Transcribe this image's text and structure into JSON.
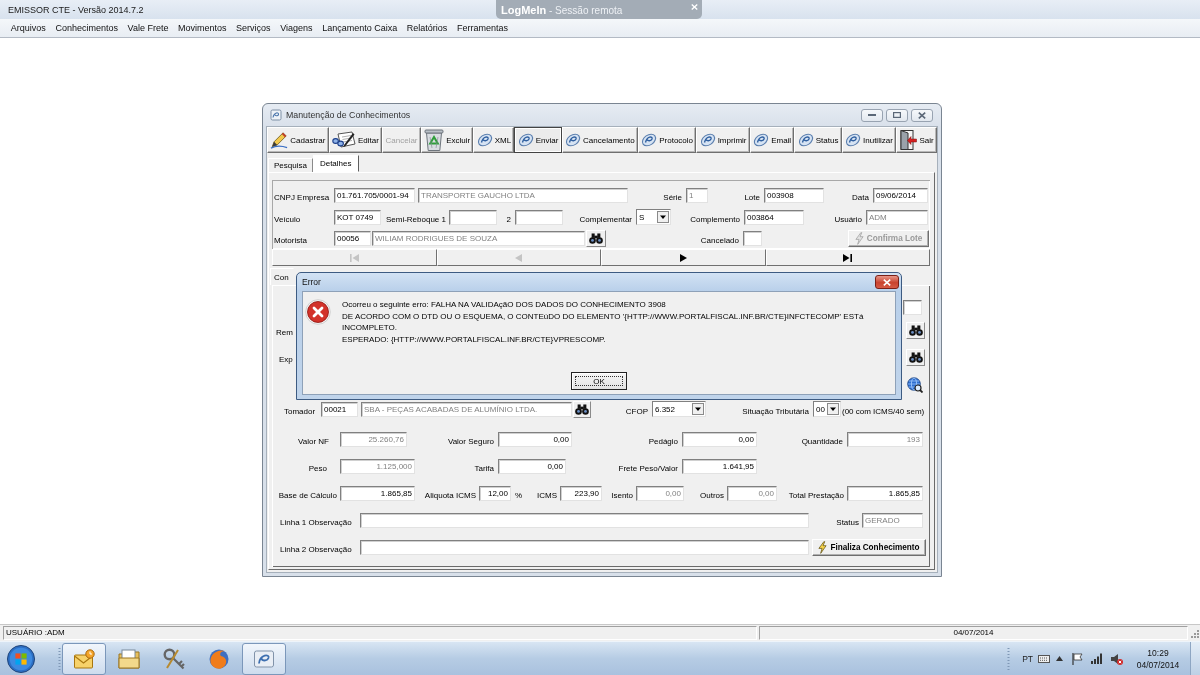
{
  "app": {
    "title": "EMISSOR CTE - Versão 2014.7.2",
    "menu": [
      "Arquivos",
      "Conhecimentos",
      "Vale Frete",
      "Movimentos",
      "Serviços",
      "Viagens",
      "Lançamento Caixa",
      "Relatórios",
      "Ferramentas"
    ]
  },
  "remote_banner": {
    "text": "**LogMeIn** - Sessão remota"
  },
  "window": {
    "title": "Manutenção de Conhecimentos",
    "toolbar": [
      {
        "label": "Cadastrar",
        "kind": "pen",
        "disabled": false,
        "pressed": false
      },
      {
        "label": "Editar",
        "kind": "writing",
        "disabled": false,
        "pressed": false
      },
      {
        "label": "Cancelar",
        "kind": "plain",
        "disabled": true,
        "pressed": false
      },
      {
        "label": "Excluir",
        "kind": "recycle",
        "disabled": false,
        "pressed": false
      },
      {
        "label": "XML",
        "kind": "swirl",
        "disabled": false,
        "pressed": false
      },
      {
        "label": "Enviar",
        "kind": "swirl",
        "disabled": false,
        "pressed": true
      },
      {
        "label": "Cancelamento",
        "kind": "swirl",
        "disabled": false,
        "pressed": false
      },
      {
        "label": "Protocolo",
        "kind": "swirl",
        "disabled": false,
        "pressed": false
      },
      {
        "label": "Imprimir",
        "kind": "swirl",
        "disabled": false,
        "pressed": false
      },
      {
        "label": "Email",
        "kind": "swirl",
        "disabled": false,
        "pressed": false
      },
      {
        "label": "Status",
        "kind": "swirl",
        "disabled": false,
        "pressed": false
      },
      {
        "label": "Inutilizar",
        "kind": "swirl",
        "disabled": false,
        "pressed": false
      },
      {
        "label": "Sair",
        "kind": "door",
        "disabled": false,
        "pressed": false
      }
    ],
    "tabs": [
      {
        "label": "Pesquisa",
        "selected": false
      },
      {
        "label": "Detalhes",
        "selected": true
      }
    ],
    "header": {
      "rows": [
        {
          "items": [
            {
              "kind": "label",
              "text": "CNPJ Empresa"
            },
            {
              "kind": "field",
              "value": "01.761.705/0001-94",
              "disabled": false
            },
            {
              "kind": "field",
              "value": "TRANSPORTE GAUCHO LTDA",
              "disabled": true
            },
            {
              "kind": "label",
              "text": "Série"
            },
            {
              "kind": "field",
              "value": "1",
              "disabled": true
            },
            {
              "kind": "label",
              "text": "Lote"
            },
            {
              "kind": "field",
              "value": "003908",
              "disabled": false
            },
            {
              "kind": "label",
              "text": "Data"
            },
            {
              "kind": "field",
              "value": "09/06/2014",
              "disabled": false
            }
          ]
        },
        {
          "items": [
            {
              "kind": "label",
              "text": "Veículo"
            },
            {
              "kind": "field",
              "value": "KOT 0749",
              "disabled": false
            },
            {
              "kind": "label",
              "text": "Semi-Reboque 1"
            },
            {
              "kind": "field"
            },
            {
              "kind": "label",
              "text": "2"
            },
            {
              "kind": "field"
            },
            {
              "kind": "label",
              "text": "Complementar"
            },
            {
              "kind": "select",
              "value": "S"
            },
            {
              "kind": "label",
              "text": "Complemento"
            },
            {
              "kind": "field",
              "value": "003864",
              "disabled": false
            },
            {
              "kind": "label",
              "text": "Usuário"
            },
            {
              "kind": "field",
              "value": "ADM",
              "disabled": true
            }
          ]
        },
        {
          "items": [
            {
              "kind": "label",
              "text": "Motorista"
            },
            {
              "kind": "field",
              "value": "00056",
              "disabled": false
            },
            {
              "kind": "field",
              "value": "WILIAM RODRIGUES DE SOUZA",
              "disabled": true
            },
            {
              "kind": "search"
            },
            {
              "kind": "label",
              "text": "Cancelado"
            },
            {
              "kind": "field"
            },
            {
              "kind": "button",
              "label": "Confirma Lote",
              "disabled": true
            }
          ]
        }
      ]
    },
    "navigator": [
      {
        "kind": "first",
        "disabled": true
      },
      {
        "kind": "prior",
        "disabled": true
      },
      {
        "kind": "next",
        "disabled": false
      },
      {
        "kind": "last",
        "disabled": false
      }
    ],
    "subtabs": [
      {
        "label": "Con",
        "selected": true
      }
    ],
    "detail": {
      "rows": [
        {
          "items": [
            {
              "kind": "field"
            }
          ]
        },
        {
          "items": [
            {
              "kind": "label",
              "text": "Rem"
            },
            {
              "kind": "search"
            }
          ]
        },
        {
          "items": [
            {
              "kind": "label",
              "text": "Exp"
            },
            {
              "kind": "search"
            }
          ]
        },
        {
          "items": [
            {
              "kind": "web_search"
            }
          ]
        },
        {
          "items": [
            {
              "kind": "label",
              "text": "Tomador"
            },
            {
              "kind": "field",
              "value": "00021",
              "disabled": false
            },
            {
              "kind": "field",
              "value": "SBA - PEÇAS ACABADAS DE ALUMÍNIO LTDA.",
              "disabled": true
            },
            {
              "kind": "search"
            },
            {
              "kind": "label",
              "text": "CFOP"
            },
            {
              "kind": "select",
              "value": "6.352"
            },
            {
              "kind": "label",
              "text": "Situação Tributária"
            },
            {
              "kind": "select",
              "value": "00"
            },
            {
              "kind": "label",
              "text": "(00 com ICMS/40 sem)"
            }
          ]
        },
        {
          "items": [
            {
              "kind": "label",
              "text": "Valor NF"
            },
            {
              "kind": "field",
              "value": "25.260,76",
              "disabled": true
            },
            {
              "kind": "label",
              "text": "Valor Seguro"
            },
            {
              "kind": "field",
              "value": "0,00",
              "disabled": false
            },
            {
              "kind": "label",
              "text": "Pedágio"
            },
            {
              "kind": "field",
              "value": "0,00",
              "disabled": false
            },
            {
              "kind": "label",
              "text": "Quantidade"
            },
            {
              "kind": "field",
              "value": "193",
              "disabled": true
            }
          ]
        },
        {
          "items": [
            {
              "kind": "label",
              "text": "Peso"
            },
            {
              "kind": "field",
              "value": "1.125,000",
              "disabled": true
            },
            {
              "kind": "label",
              "text": "Tarifa"
            },
            {
              "kind": "field",
              "value": "0,00",
              "disabled": false
            },
            {
              "kind": "label",
              "text": "Frete Peso/Valor"
            },
            {
              "kind": "field",
              "value": "1.641,95",
              "disabled": false
            }
          ]
        },
        {
          "items": [
            {
              "kind": "label",
              "text": "Base de Cálculo"
            },
            {
              "kind": "field",
              "value": "1.865,85",
              "disabled": false
            },
            {
              "kind": "label",
              "text": "Aliquota ICMS"
            },
            {
              "kind": "field",
              "value": "12,00",
              "disabled": false
            },
            {
              "kind": "label",
              "text": "%"
            },
            {
              "kind": "label",
              "text": "ICMS"
            },
            {
              "kind": "field",
              "value": "223,90",
              "disabled": false
            },
            {
              "kind": "label",
              "text": "Isento"
            },
            {
              "kind": "field",
              "value": "0,00",
              "disabled": true
            },
            {
              "kind": "label",
              "text": "Outros"
            },
            {
              "kind": "field",
              "value": "0,00",
              "disabled": true
            },
            {
              "kind": "label",
              "text": "Total Prestação"
            },
            {
              "kind": "field",
              "value": "1.865,85",
              "disabled": false
            }
          ]
        },
        {
          "items": [
            {
              "kind": "label",
              "text": "Linha 1 Observação"
            },
            {
              "kind": "field"
            },
            {
              "kind": "label",
              "text": "Status"
            },
            {
              "kind": "field",
              "value": "GERADO",
              "disabled": true
            }
          ]
        },
        {
          "items": [
            {
              "kind": "label",
              "text": "Linha 2 Observação"
            },
            {
              "kind": "field"
            },
            {
              "kind": "button",
              "label": "Finaliza Conhecimento",
              "disabled": false
            }
          ]
        }
      ]
    }
  },
  "error_dialog": {
    "title": "Error",
    "message": [
      "Ocorreu o seguinte erro: FALHA NA VALIDAçãO DOS DADOS DO CONHECIMENTO 3908",
      "DE ACORDO COM O DTD OU O ESQUEMA, O CONTEúDO DO ELEMENTO '{HTTP://WWW.PORTALFISCAL.INF.BR/CTE}INFCTECOMP' ESTá INCOMPLETO.",
      "ESPERADO: {HTTP://WWW.PORTALFISCAL.INF.BR/CTE}VPRESCOMP."
    ],
    "button": "OK"
  },
  "status_bar": {
    "user": "USUÁRIO :ADM",
    "date": "04/07/2014"
  },
  "taskbar": {
    "apps": [
      {
        "kind": "mail",
        "highlighted": true
      },
      {
        "kind": "folder",
        "highlighted": false
      },
      {
        "kind": "tools",
        "highlighted": false
      },
      {
        "kind": "browser",
        "highlighted": false
      },
      {
        "kind": "swirl",
        "highlighted": true
      }
    ],
    "tray": {
      "language": "PT",
      "time": "10:29",
      "date": "04/07/2014"
    }
  }
}
